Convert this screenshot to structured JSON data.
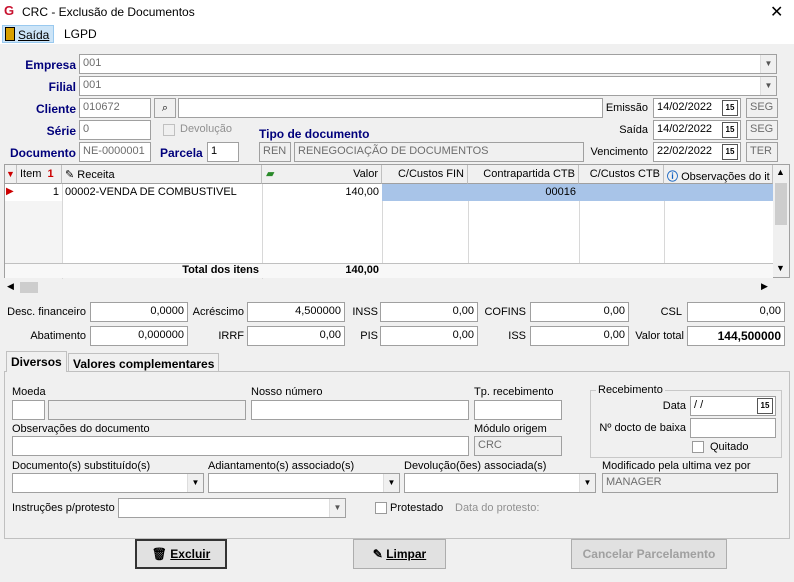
{
  "window": {
    "title": "CRC - Exclusão de Documentos",
    "close_glyph": "✕"
  },
  "menu": {
    "saida": "Saída",
    "lgpd": "LGPD"
  },
  "header": {
    "empresa_label": "Empresa",
    "empresa_value": "001",
    "filial_label": "Filial",
    "filial_value": "001",
    "cliente_label": "Cliente",
    "cliente_value": "010672",
    "cliente_name": "",
    "serie_label": "Série",
    "serie_value": "0",
    "devolucao_label": "Devolução",
    "documento_label": "Documento",
    "documento_value": "NE-0000001",
    "parcela_label": "Parcela",
    "parcela_value": "1",
    "tipo_doc_label": "Tipo de documento",
    "tipo_doc_code": "REN",
    "tipo_doc_desc": "RENEGOCIAÇÃO DE DOCUMENTOS",
    "emissao_label": "Emissão",
    "emissao_value": "14/02/2022",
    "emissao_day": "SEG",
    "saida_label": "Saída",
    "saida_value": "14/02/2022",
    "saida_day": "SEG",
    "vencimento_label": "Vencimento",
    "vencimento_value": "22/02/2022",
    "vencimento_day": "TER"
  },
  "grid": {
    "columns": [
      "Item",
      "Receita",
      "Valor",
      "C/Custos FIN",
      "Contrapartida CTB",
      "C/Custos CTB",
      "Observações do it"
    ],
    "rows": [
      {
        "item": "1",
        "receita": "00002-VENDA DE COMBUSTIVEL",
        "valor": "140,00",
        "ccustos_fin": "",
        "contrapartida": "00016",
        "ccustos_ctb": "",
        "obs": ""
      }
    ],
    "total_label": "Total dos itens",
    "total_value": "140,00"
  },
  "totals": {
    "desc_fin_label": "Desc. financeiro",
    "desc_fin_value": "0,0000",
    "acrescimo_label": "Acréscimo",
    "acrescimo_value": "4,500000",
    "inss_label": "INSS",
    "inss_value": "0,00",
    "cofins_label": "COFINS",
    "cofins_value": "0,00",
    "csl_label": "CSL",
    "csl_value": "0,00",
    "abatimento_label": "Abatimento",
    "abatimento_value": "0,000000",
    "irrf_label": "IRRF",
    "irrf_value": "0,00",
    "pis_label": "PIS",
    "pis_value": "0,00",
    "iss_label": "ISS",
    "iss_value": "0,00",
    "valor_total_label": "Valor total",
    "valor_total_value": "144,500000"
  },
  "tabs": {
    "diversos": "Diversos",
    "valores": "Valores complementares"
  },
  "diversos": {
    "moeda_label": "Moeda",
    "nosso_numero_label": "Nosso número",
    "tp_recebimento_label": "Tp. recebimento",
    "recebimento_group": "Recebimento",
    "data_label": "Data",
    "data_value": " /  /",
    "docto_baixa_label": "Nº docto de baixa",
    "quitado_label": "Quitado",
    "obs_doc_label": "Observações do documento",
    "modulo_origem_label": "Módulo origem",
    "modulo_origem_value": "CRC",
    "doc_subst_label": "Documento(s) substituído(s)",
    "adiant_label": "Adiantamento(s) associado(s)",
    "devol_label": "Devolução(ões) associada(s)",
    "modificado_label": "Modificado pela ultima vez por",
    "modificado_value": "MANAGER",
    "instrucoes_label": "Instruções p/protesto",
    "protestado_label": "Protestado",
    "data_protesto_label": "Data do protesto:"
  },
  "buttons": {
    "excluir": "Excluir",
    "limpar": "Limpar",
    "cancelar": "Cancelar Parcelamento"
  }
}
